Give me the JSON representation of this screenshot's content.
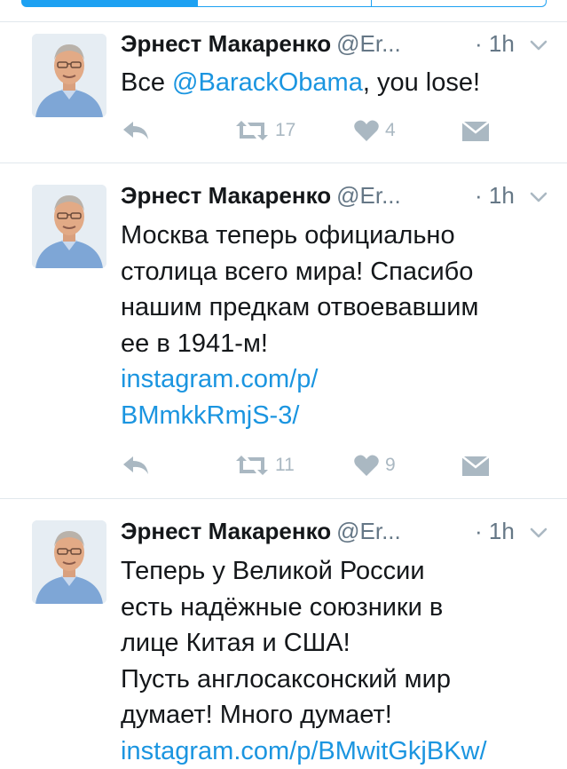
{
  "tweets": [
    {
      "author": "Эрнест Макаренко",
      "handle": "@Er...",
      "time": "· 1h",
      "text_plain": "Все ",
      "mention": "@BarackObama",
      "text_after": ", you lose!",
      "retweets": "17",
      "likes": "4"
    },
    {
      "author": "Эрнест Макаренко",
      "handle": "@Er...",
      "time": "· 1h",
      "lines": [
        "Москва теперь официально",
        "столица всего мира! Спасибо",
        "нашим предкам отвоевавшим",
        "ее в 1941-м!"
      ],
      "link_lines": [
        "instagram.com/p/",
        "BMmkkRmjS-3/"
      ],
      "retweets": "11",
      "likes": "9"
    },
    {
      "author": "Эрнест Макаренко",
      "handle": "@Er...",
      "time": "· 1h",
      "lines": [
        "Теперь у Великой России",
        "есть надёжные союзники в",
        "лице Китая и США!",
        "Пусть англосаксонский мир",
        "думает! Много думает!"
      ],
      "link_partial": "instagram.com/p/BMwitGkjBKw/"
    }
  ],
  "icons": {
    "reply": "reply-icon",
    "retweet": "retweet-icon",
    "like": "heart-icon",
    "dm": "envelope-icon",
    "caret": "chevron-down-icon"
  },
  "colors": {
    "link": "#1b95e0",
    "muted": "#657786",
    "icon": "#aab8c2",
    "divider": "#e1e8ed",
    "accent": "#1da1f2"
  }
}
